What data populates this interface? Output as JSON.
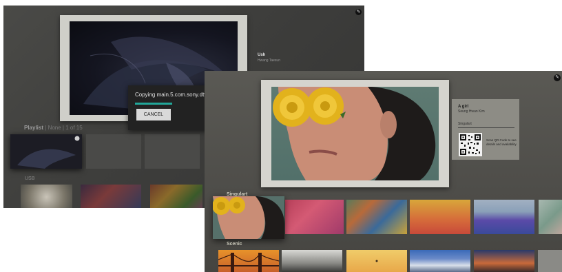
{
  "back_screen": {
    "artwork": {
      "title": "Ush",
      "artist": "Hwang Taesun"
    },
    "copy_dialog": {
      "message": "Copying main.5.com.sony.dtv",
      "progress": 0.34,
      "cancel_label": "CANCEL"
    },
    "playlist": {
      "label": "Playlist",
      "mode": "None",
      "count": "1 of 15"
    },
    "usb_label": "USB"
  },
  "front_screen": {
    "artwork": {
      "title": "A girl",
      "artist": "Seung Hwan Kim",
      "collection": "Singulart",
      "qr_caption": "Scan QR Code to see details and availability"
    },
    "categories": [
      {
        "label": "Singulart"
      },
      {
        "label": "Scenic"
      }
    ]
  },
  "colors": {
    "progress_accent": "#22a79a",
    "rose_yellow": "#e2b21c",
    "dialog_bg": "#222222"
  },
  "icons": [
    "settings-badge-icon",
    "qr-code-icon"
  ]
}
